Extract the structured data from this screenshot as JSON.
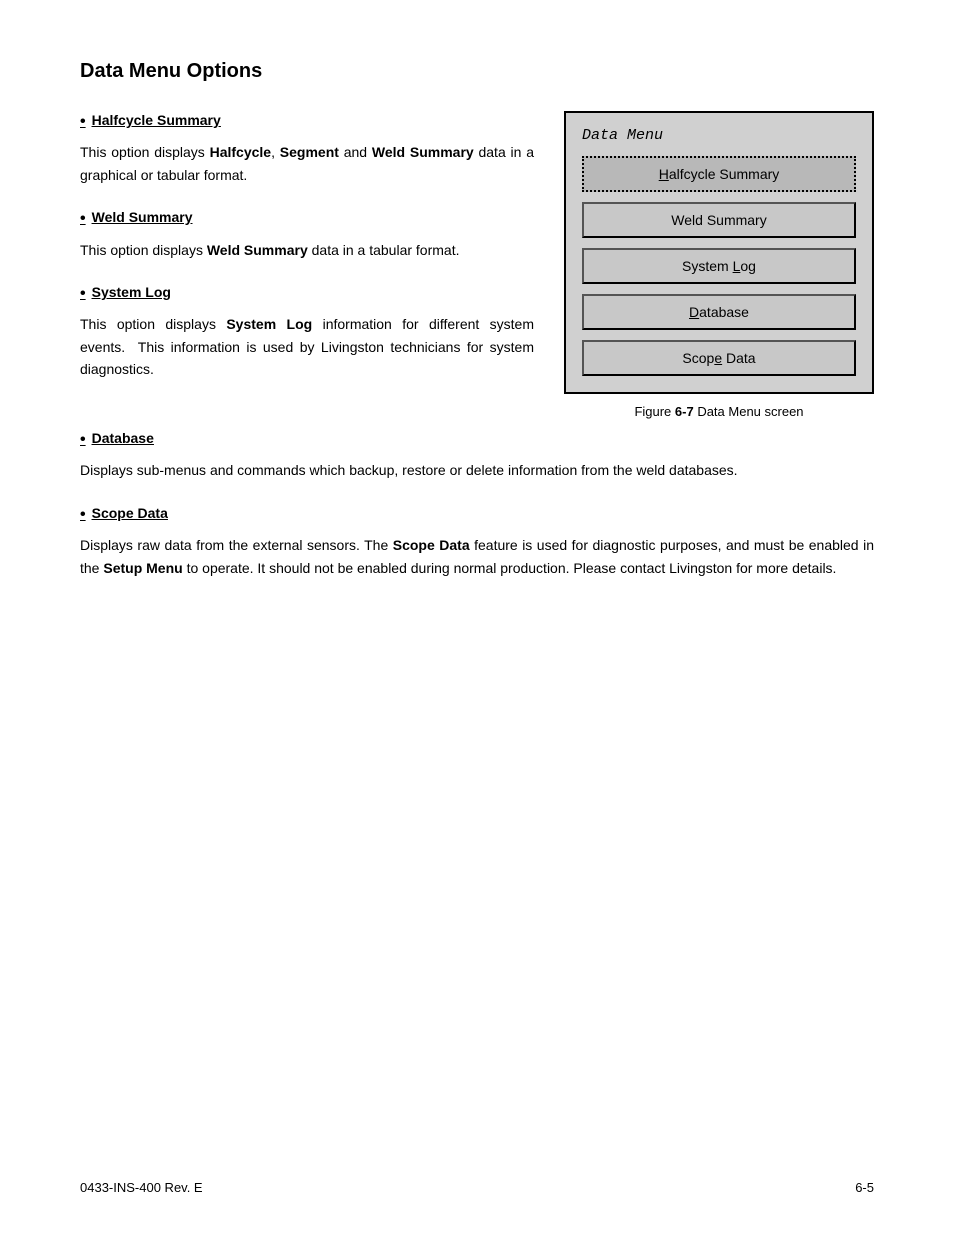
{
  "page": {
    "title": "Data Menu Options",
    "footer": {
      "left": "0433-INS-400 Rev. E",
      "right": "6-5"
    }
  },
  "dataMenu": {
    "title": "Data Menu",
    "buttons": [
      {
        "label": "Halfcycle Summary",
        "underline_index": 4,
        "selected": true
      },
      {
        "label": "Weld Summary",
        "underline_index": 5,
        "selected": false
      },
      {
        "label": "System Log",
        "underline_index": 7,
        "selected": false
      },
      {
        "label": "Database",
        "underline_index": 0,
        "selected": false
      },
      {
        "label": "Scope Data",
        "underline_index": 6,
        "selected": false
      }
    ],
    "figure_caption_prefix": "Figure ",
    "figure_caption_bold": "6-7",
    "figure_caption_suffix": " Data Menu screen"
  },
  "sections": [
    {
      "id": "halfcycle-summary",
      "title": "Halfcycle Summary",
      "body_parts": [
        {
          "text": "This option displays ",
          "bold": false
        },
        {
          "text": "Halfcycle",
          "bold": true
        },
        {
          "text": ", ",
          "bold": false
        },
        {
          "text": "Segment",
          "bold": true
        },
        {
          "text": " and ",
          "bold": false
        },
        {
          "text": "Weld Summary",
          "bold": true
        },
        {
          "text": " data in a graphical or tabular format.",
          "bold": false
        }
      ]
    },
    {
      "id": "weld-summary",
      "title": "Weld Summary",
      "body_parts": [
        {
          "text": "This option displays ",
          "bold": false
        },
        {
          "text": "Weld Summary",
          "bold": true
        },
        {
          "text": " data in a tabular format.",
          "bold": false
        }
      ]
    },
    {
      "id": "system-log",
      "title": "System Log",
      "body_parts": [
        {
          "text": "This option displays ",
          "bold": false
        },
        {
          "text": "System Log",
          "bold": true
        },
        {
          "text": " information for different system events.  This information is used by Livingston technicians for system diagnostics.",
          "bold": false
        }
      ]
    },
    {
      "id": "database",
      "title": "Database",
      "body_parts": [
        {
          "text": "Displays sub-menus and commands which backup, restore or delete information from the weld databases.",
          "bold": false
        }
      ]
    },
    {
      "id": "scope-data",
      "title": "Scope Data",
      "body_parts": [
        {
          "text": "Displays raw data from the external sensors. The ",
          "bold": false
        },
        {
          "text": "Scope Data",
          "bold": true
        },
        {
          "text": " feature is used for diagnostic purposes, and must be enabled in the ",
          "bold": false
        },
        {
          "text": "Setup Menu",
          "bold": true
        },
        {
          "text": " to operate. It should not be enabled during normal production. Please contact Livingston for more details.",
          "bold": false
        }
      ]
    }
  ]
}
